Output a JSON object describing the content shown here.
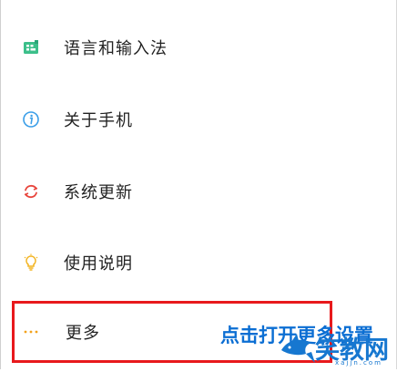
{
  "menu": {
    "items": [
      {
        "label": "语言和输入法",
        "icon": "language-icon"
      },
      {
        "label": "关于手机",
        "icon": "info-icon"
      },
      {
        "label": "系统更新",
        "icon": "refresh-icon"
      },
      {
        "label": "使用说明",
        "icon": "bulb-icon"
      },
      {
        "label": "更多",
        "icon": "more-dots-icon"
      }
    ]
  },
  "annotation": {
    "caption": "点击打开更多设置",
    "highlight_color": "#e8191c"
  },
  "watermark": {
    "text": "笑教网",
    "url": "xajjn.com"
  },
  "colors": {
    "language_icon": "#3cbf8a",
    "info_icon": "#3a9ee8",
    "refresh_icon": "#e8453c",
    "bulb_icon": "#f2b21c",
    "more_icon": "#f2a21c"
  }
}
